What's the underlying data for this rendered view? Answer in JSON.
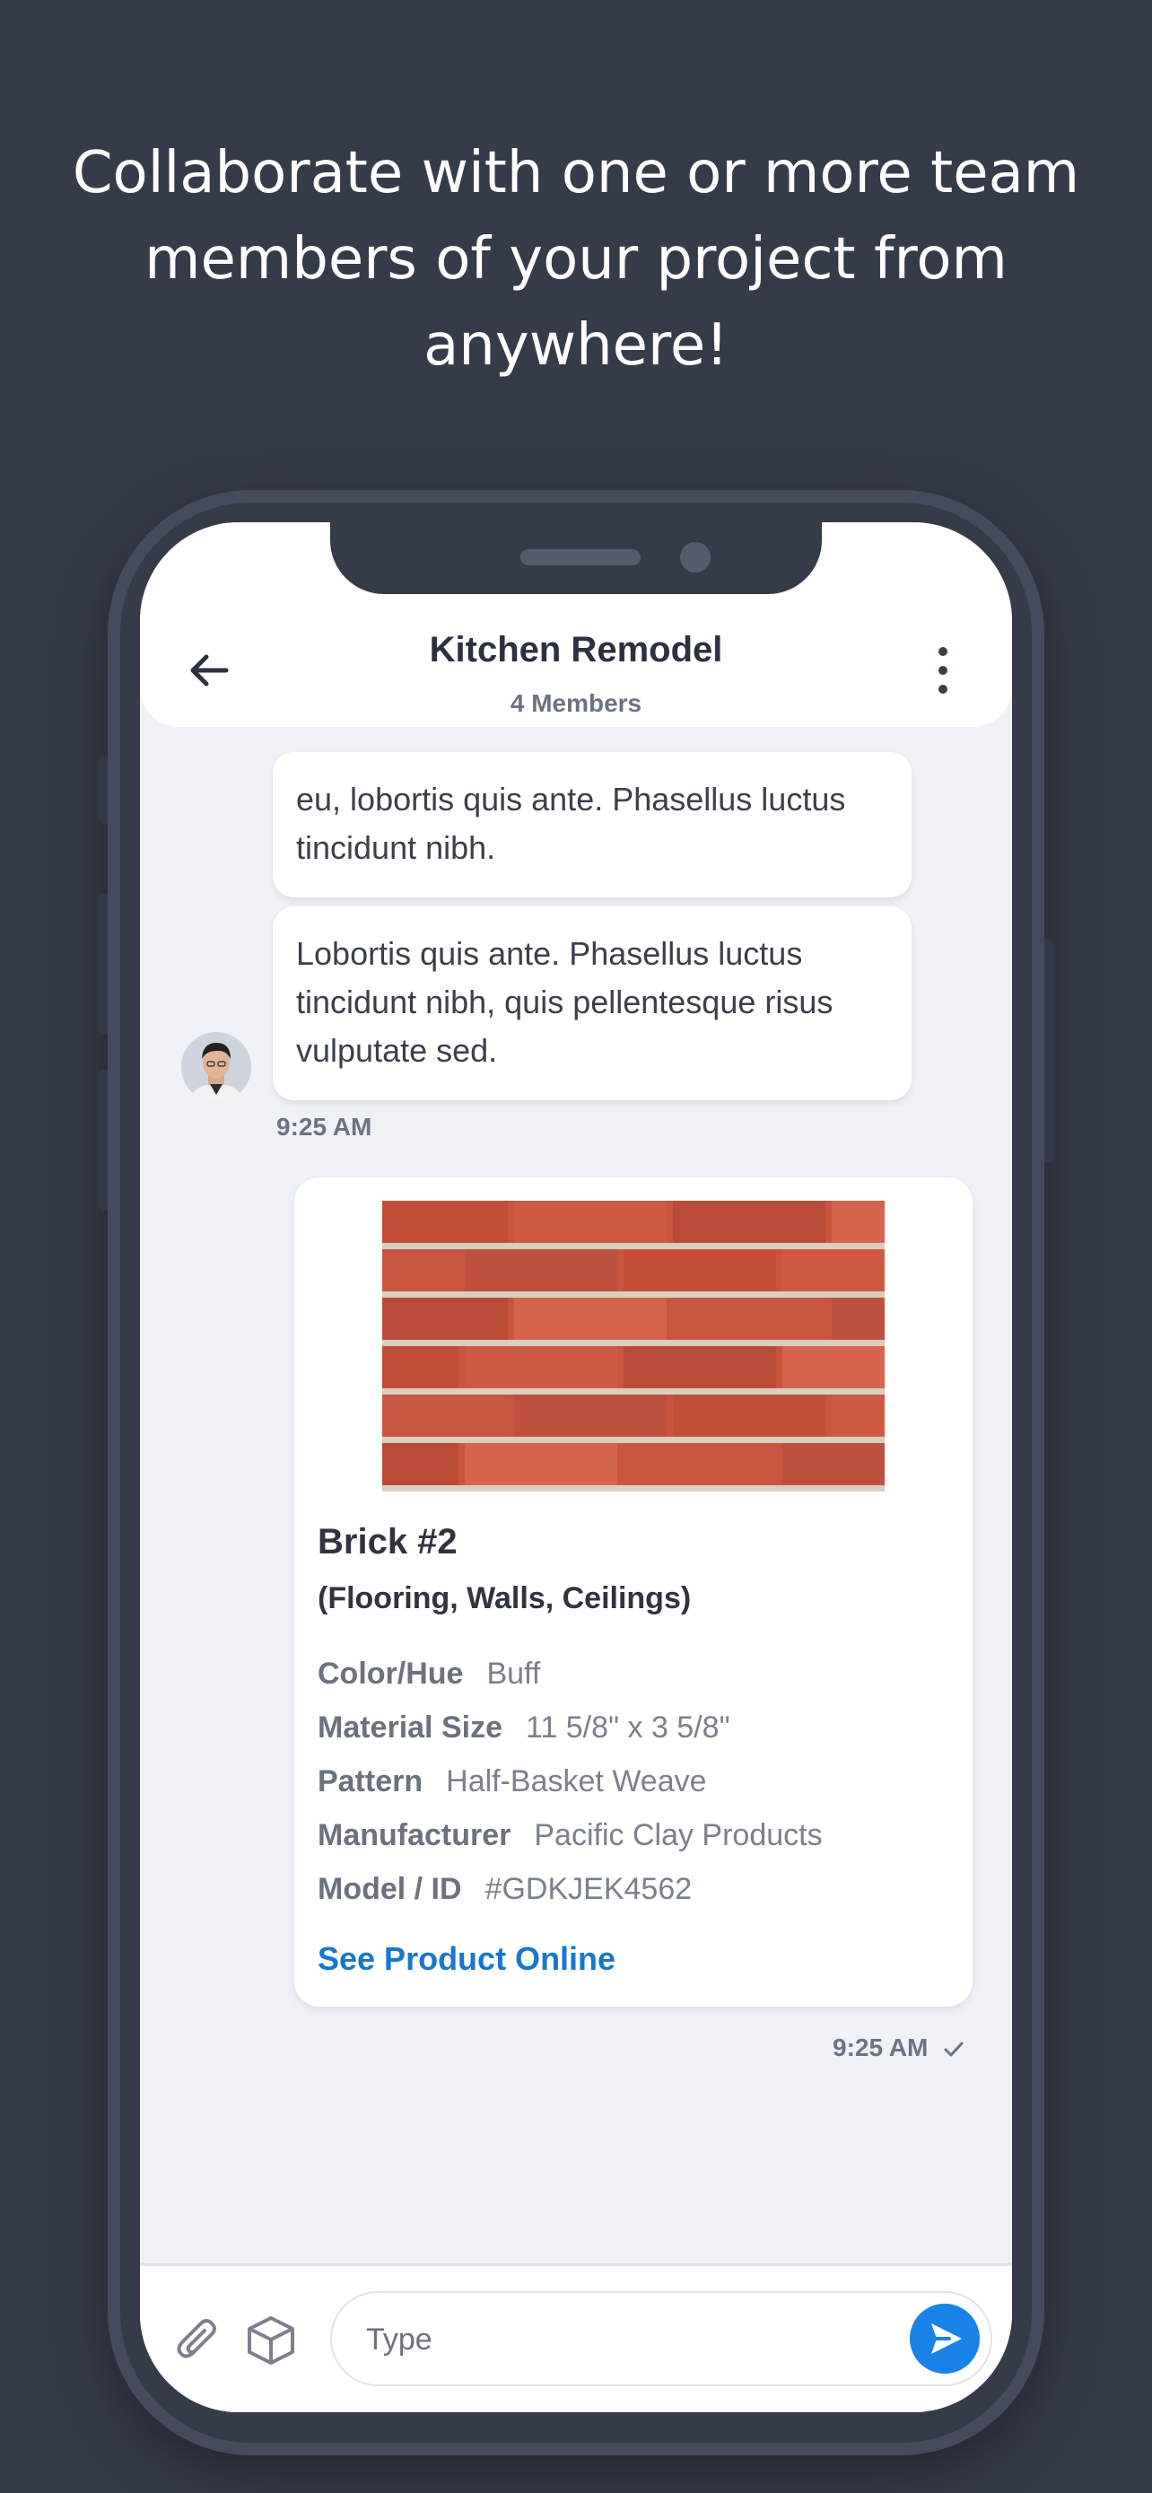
{
  "headline": "Collaborate with one or more team\nmembers of your project from\nanywhere!",
  "header": {
    "title": "Kitchen Remodel",
    "subtitle": "4 Members"
  },
  "messages": [
    {
      "text": " eu, lobortis quis ante. Phasellus luctus tincidunt nibh."
    },
    {
      "text": "Lobortis quis ante. Phasellus luctus tincidunt nibh, quis pellentesque risus vulputate sed."
    }
  ],
  "incoming_time": "9:25 AM",
  "product_card": {
    "title": "Brick #2",
    "subtitle": "(Flooring, Walls, Ceilings)",
    "specs": [
      {
        "label": "Color/Hue",
        "value": "Buff"
      },
      {
        "label": "Material Size",
        "value": "11 5/8\" x 3 5/8\""
      },
      {
        "label": "Pattern",
        "value": "Half-Basket Weave"
      },
      {
        "label": "Manufacturer",
        "value": "Pacific Clay Products"
      },
      {
        "label": "Model / ID",
        "value": "#GDKJEK4562"
      }
    ],
    "link": "See Product Online"
  },
  "outgoing_time": "9:25 AM",
  "composer": {
    "placeholder": "Type"
  },
  "colors": {
    "background": "#363b4a",
    "accent": "#1783e6",
    "link": "#1777cf",
    "chat_background": "#eef1f6"
  }
}
